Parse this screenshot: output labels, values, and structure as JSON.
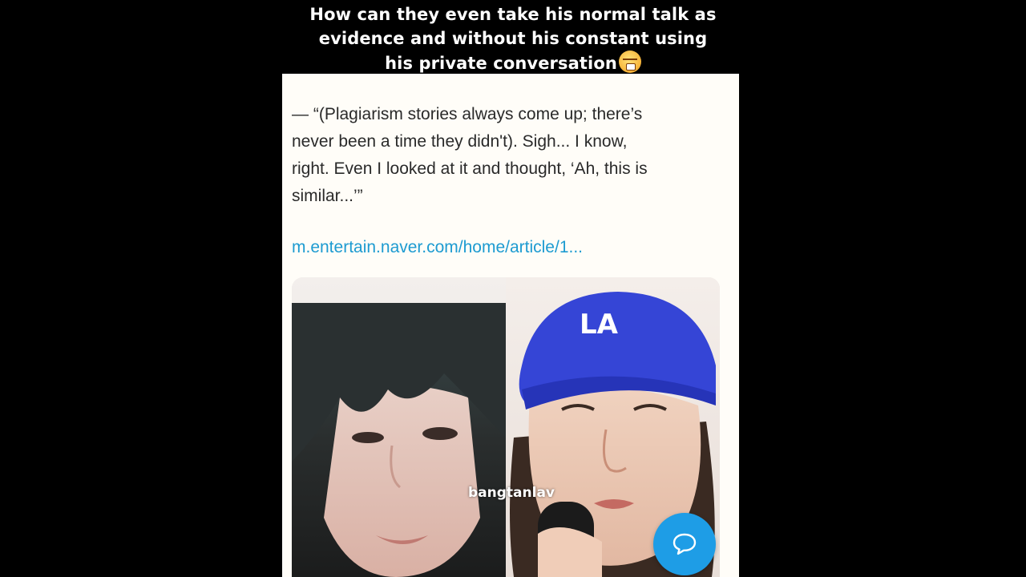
{
  "caption": {
    "line1": "How can they even take his normal talk as",
    "line2": "evidence and without his constant using",
    "line3": "his private conversation",
    "emoji_icon": "steam-from-nose-emoji"
  },
  "post": {
    "quote_lines": [
      "— “(Plagiarism stories always come up; there’s",
      "never been a time they didn't). Sigh... I know,",
      "right. Even I looked at it and thought, ‘Ah, this is",
      "similar...’”"
    ],
    "link_text": "m.entertain.naver.com/home/article/1...",
    "link_color": "#1d9bd1",
    "cap_logo": "LA"
  },
  "watermark": "bangtanlav",
  "chat_button": {
    "icon": "speech-bubble-icon",
    "color": "#1e9de6"
  }
}
